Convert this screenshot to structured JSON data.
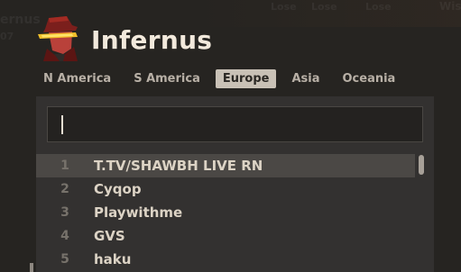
{
  "background": {
    "ghost_top_left": "ernus",
    "ghost_sub": "07",
    "ghost_right": [
      "Lose",
      "Lose",
      "Lose",
      "Wis"
    ]
  },
  "hero": {
    "name": "Infernus",
    "icon": "hero-portrait-icon"
  },
  "regions": [
    {
      "label": "N America",
      "active": false
    },
    {
      "label": "S America",
      "active": false
    },
    {
      "label": "Europe",
      "active": true
    },
    {
      "label": "Asia",
      "active": false
    },
    {
      "label": "Oceania",
      "active": false
    }
  ],
  "search": {
    "value": "",
    "placeholder": ""
  },
  "leaderboard": [
    {
      "rank": "1",
      "name": "T.TV/SHAWBH LIVE RN",
      "highlight": true
    },
    {
      "rank": "2",
      "name": "Cyqop",
      "highlight": false
    },
    {
      "rank": "3",
      "name": "Playwithme",
      "highlight": false
    },
    {
      "rank": "4",
      "name": "GVS",
      "highlight": false
    },
    {
      "rank": "5",
      "name": "haku",
      "highlight": false
    }
  ],
  "colors": {
    "background": "#272522",
    "panel": "#333130",
    "active_tab": "#c9c1b6",
    "row_highlight": "#4b4845",
    "hero_name": "#f2e9dc"
  }
}
